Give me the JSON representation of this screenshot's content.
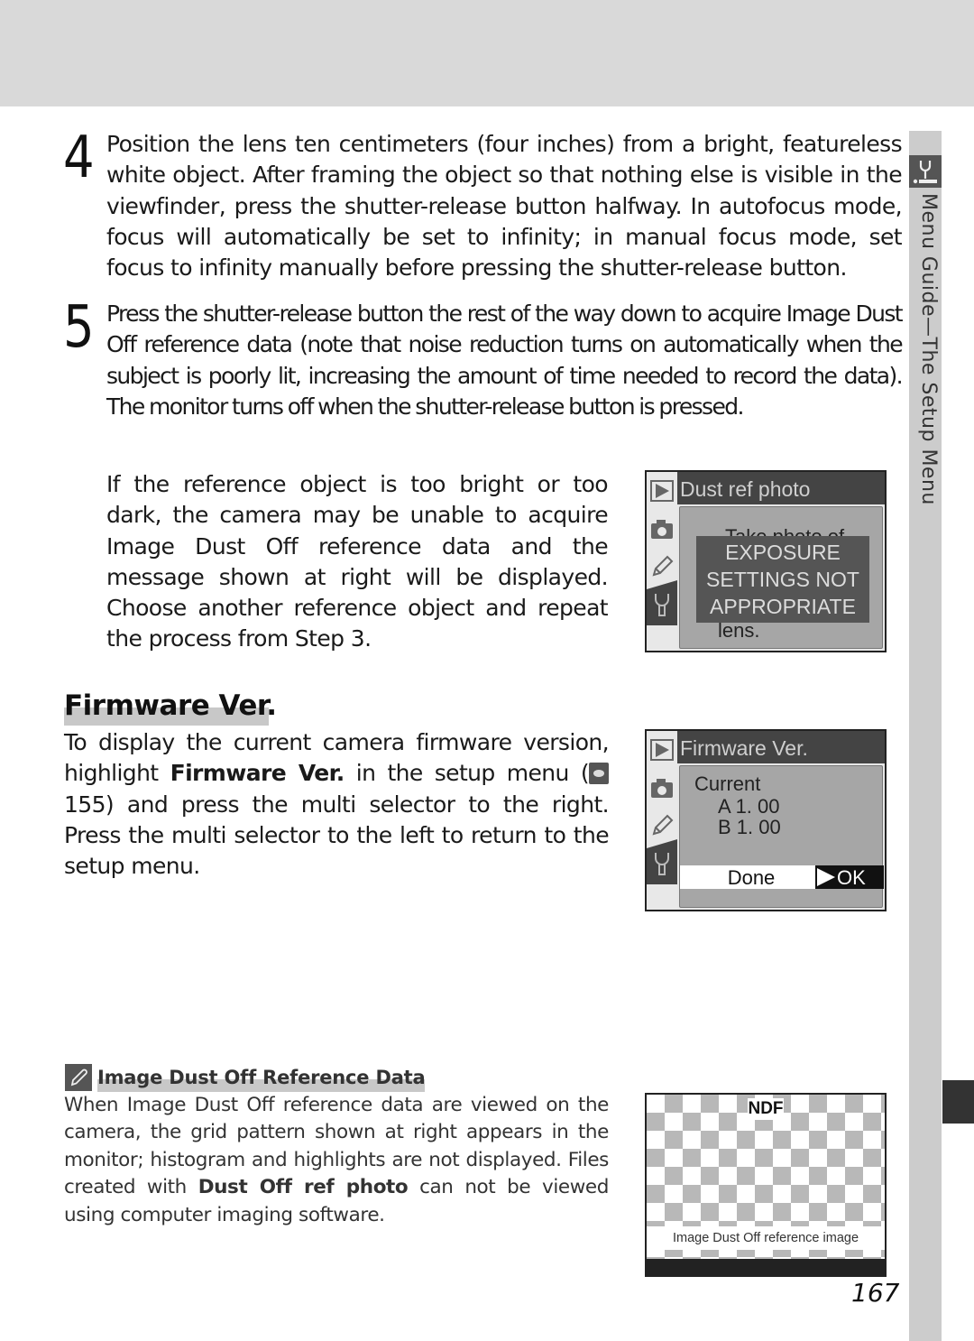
{
  "side_tab": {
    "icon": "wrench-setup-icon",
    "label": "Menu Guide—The Setup Menu"
  },
  "steps": [
    {
      "number": "4",
      "text": "Position the lens ten centimeters (four inches) from a bright, featureless white object.  After framing the object so that nothing else is visible in the viewfinder, press the shutter-release button halfway.  In autofocus mode, focus will automatically be set to infinity; in manual focus mode, set focus to infinity manually before pressing the shutter-release button."
    },
    {
      "number": "5",
      "text": "Press the shutter-release button the rest of the way down to acquire Image Dust Off reference data (note that noise reduction turns on automatically when the subject is poorly lit, increasing the amount of time needed to record the data).  The monitor turns off when the shutter-release button is pressed."
    }
  ],
  "reference_paragraph": "If the reference object is too bright or too dark, the camera may be unable to acquire Image Dust Off reference data and the message shown at right will be displayed.  Choose another reference object and repeat the process from Step 3.",
  "screen_dust_ref": {
    "header": "Dust ref photo",
    "background_text_top": "Take photo of",
    "background_text_bottom": "lens.",
    "warning_lines": [
      "EXPOSURE",
      "SETTINGS NOT",
      "APPROPRIATE"
    ],
    "menu_icons": [
      "playback-icon",
      "camera-icon",
      "pencil-icon",
      "wrench-icon"
    ]
  },
  "firmware_section": {
    "heading": "Firmware Ver.",
    "text_before": "To display the current camera firmware version, highlight ",
    "bold_item": "Firmware Ver.",
    "text_middle": " in the setup menu (",
    "ref_icon": "page-reference-icon",
    "text_after": " 155) and press the multi selector to the right.  Press the multi selector to the left to return to the setup menu."
  },
  "screen_firmware": {
    "header": "Firmware Ver.",
    "current_label": "Current",
    "version_a": "A 1. 00",
    "version_b": "B 1. 00",
    "done_label": "Done",
    "ok_label": "OK"
  },
  "note": {
    "icon": "note-pencil-icon",
    "title": "Image Dust Off Reference Data",
    "text_before": "When Image Dust Off reference data are viewed on the camera, the grid pattern shown at right appears in the monitor; histogram and highlights are not displayed.  Files created with ",
    "bold_item": "Dust Off ref photo",
    "text_after": " can not be viewed using computer imaging software."
  },
  "screen_ndf": {
    "badge": "NDF",
    "caption": "Image Dust Off reference image"
  },
  "page_number": "167"
}
